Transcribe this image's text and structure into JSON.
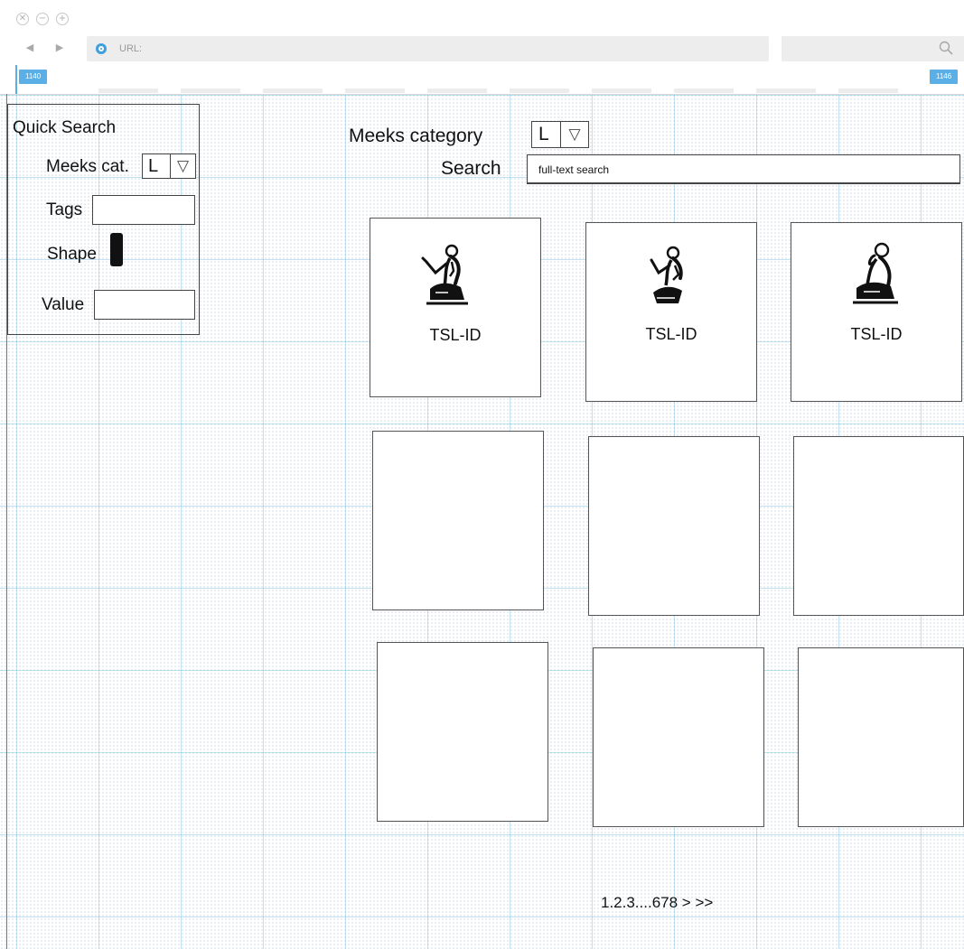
{
  "browser": {
    "close_icon": "✕",
    "minimize_icon": "−",
    "maximize_icon": "+",
    "back_icon": "◀",
    "forward_icon": "▶",
    "url_label": "URL:",
    "ruler_left": "1140",
    "ruler_right": "1146"
  },
  "quick_search": {
    "title": "Quick Search",
    "meeks_cat_label": "Meeks cat.",
    "meeks_cat_value": "L",
    "dropdown_icon": "▽",
    "tags_label": "Tags",
    "tags_value": "",
    "shape_label": "Shape",
    "value_label": "Value",
    "value_value": ""
  },
  "search": {
    "category_label": "Meeks category",
    "category_value": "L",
    "dropdown_icon": "▽",
    "search_label": "Search",
    "search_placeholder": "full-text search"
  },
  "results": {
    "cards": [
      {
        "id": "TSL-ID",
        "glyph": "seated-man-hand-raised-glyph"
      },
      {
        "id": "TSL-ID",
        "glyph": "seated-man-pointing-glyph"
      },
      {
        "id": "TSL-ID",
        "glyph": "seated-man-hand-to-mouth-glyph"
      },
      {
        "id": "",
        "glyph": ""
      },
      {
        "id": "",
        "glyph": ""
      },
      {
        "id": "",
        "glyph": ""
      },
      {
        "id": "",
        "glyph": ""
      },
      {
        "id": "",
        "glyph": ""
      },
      {
        "id": "",
        "glyph": ""
      }
    ]
  },
  "pagination": {
    "text": "1.2.3....678 > >>"
  },
  "colors": {
    "accent": "#5ab0e6",
    "border": "#444444",
    "grid": "#78bee1"
  }
}
